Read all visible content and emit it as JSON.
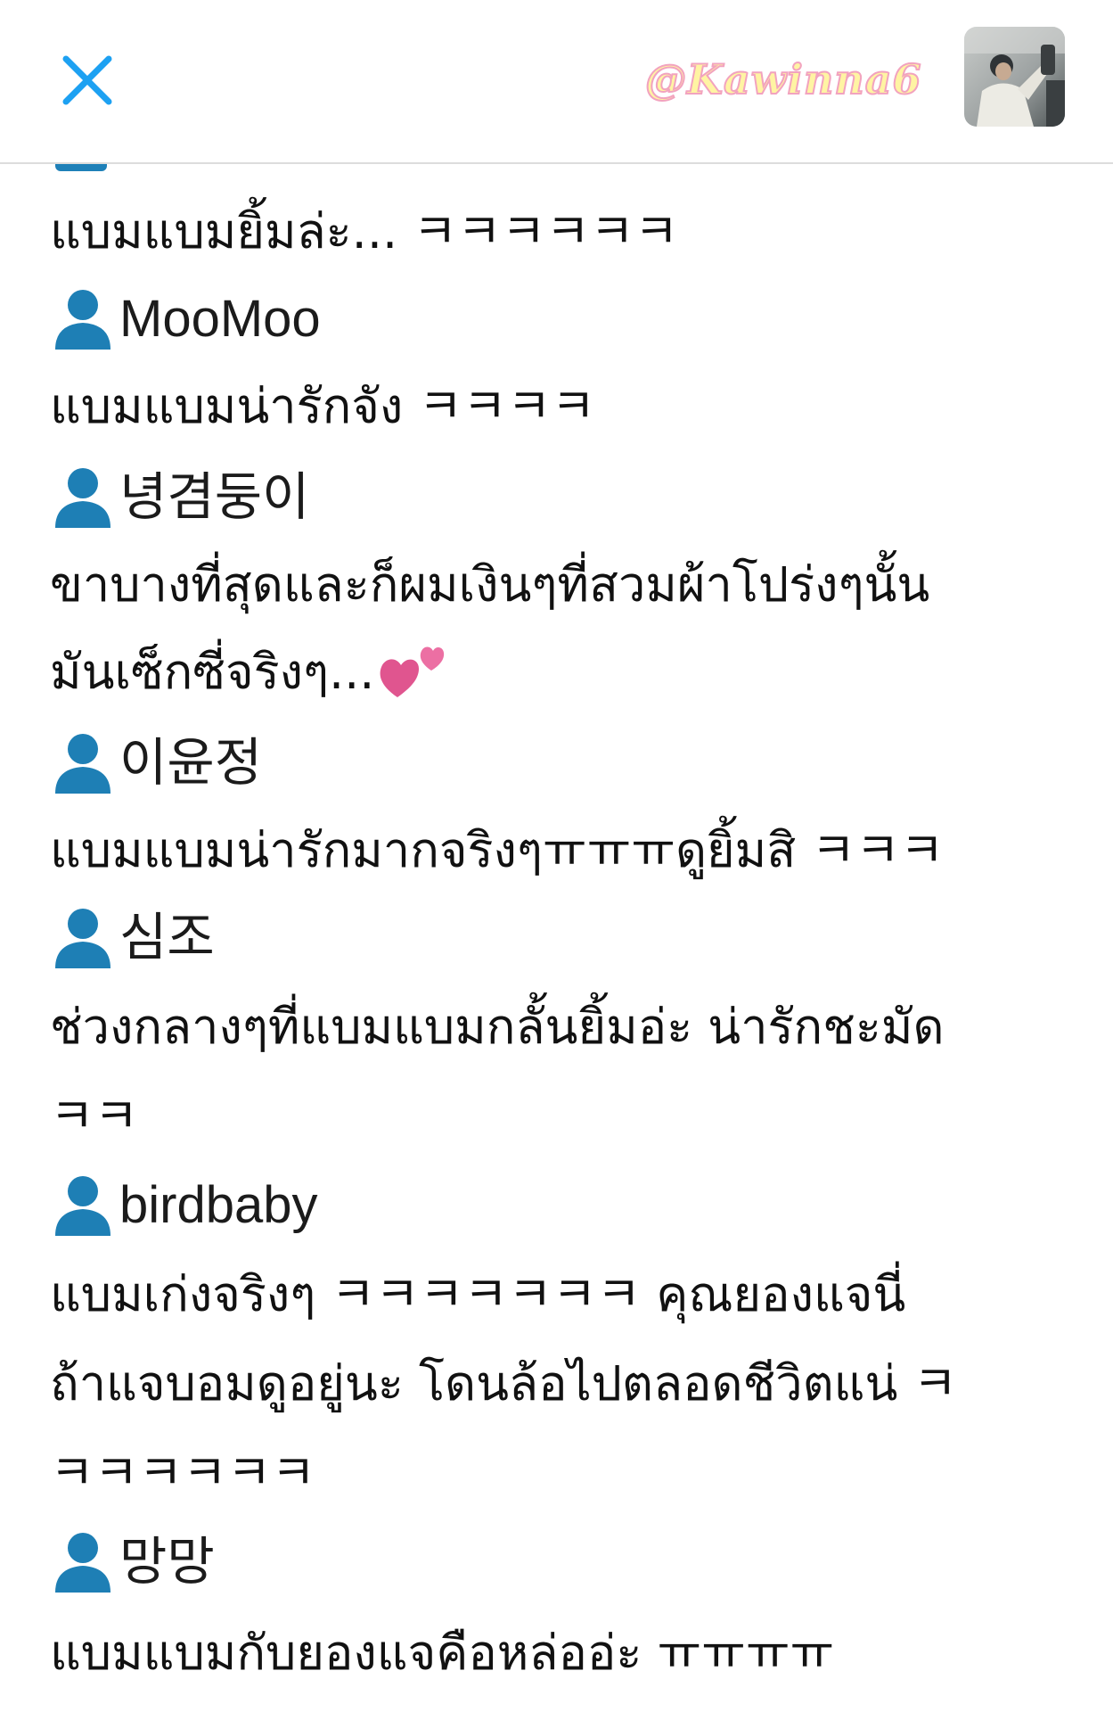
{
  "header": {
    "watermark": "@Kawinna6",
    "close_icon": "close-x-icon",
    "avatar_icon": "profile-photo",
    "accent_color": "#1da1f2"
  },
  "feed": {
    "user_icon": "person-silhouette-icon",
    "user_icon_color": "#1e7fb5",
    "lines": [
      {
        "type": "text",
        "text": "แบมแบมยิ้มล่ะ... ㅋㅋㅋㅋㅋㅋ"
      },
      {
        "type": "user",
        "text": "MooMoo"
      },
      {
        "type": "text",
        "text": "แบมแบมน่ารักจัง ㅋㅋㅋㅋ"
      },
      {
        "type": "user",
        "text": "녕겸둥이"
      },
      {
        "type": "text",
        "text": "ขาบางที่สุดและก็ผมเงินๆที่สวมผ้าโปร่งๆนั้น"
      },
      {
        "type": "text",
        "text": "มันเซ็กซี่จริงๆ...",
        "emoji": "two-hearts"
      },
      {
        "type": "user",
        "text": "이윤정"
      },
      {
        "type": "text",
        "text": "แบมแบมน่ารักมากจริงๆㅠㅠㅠดูยิ้มสิ ㅋㅋㅋ"
      },
      {
        "type": "user",
        "text": "심조"
      },
      {
        "type": "text",
        "text": "ช่วงกลางๆที่แบมแบมกลั้นยิ้มอ่ะ น่ารักชะมัด"
      },
      {
        "type": "text",
        "text": " ㅋㅋ"
      },
      {
        "type": "user",
        "text": "birdbaby"
      },
      {
        "type": "text",
        "text": "แบมเก่งจริงๆ ㅋㅋㅋㅋㅋㅋㅋ คุณยองแจนี่"
      },
      {
        "type": "text",
        "text": "ถ้าแจบอมดูอยู่นะ โดนล้อไปตลอดชีวิตแน่ ㅋ"
      },
      {
        "type": "text",
        "text": " ㅋㅋㅋㅋㅋㅋ"
      },
      {
        "type": "user",
        "text": "망망"
      },
      {
        "type": "text",
        "text": "แบมแบมกับยองแจคือหล่ออ่ะ ㅠㅠㅠㅠ"
      }
    ]
  }
}
